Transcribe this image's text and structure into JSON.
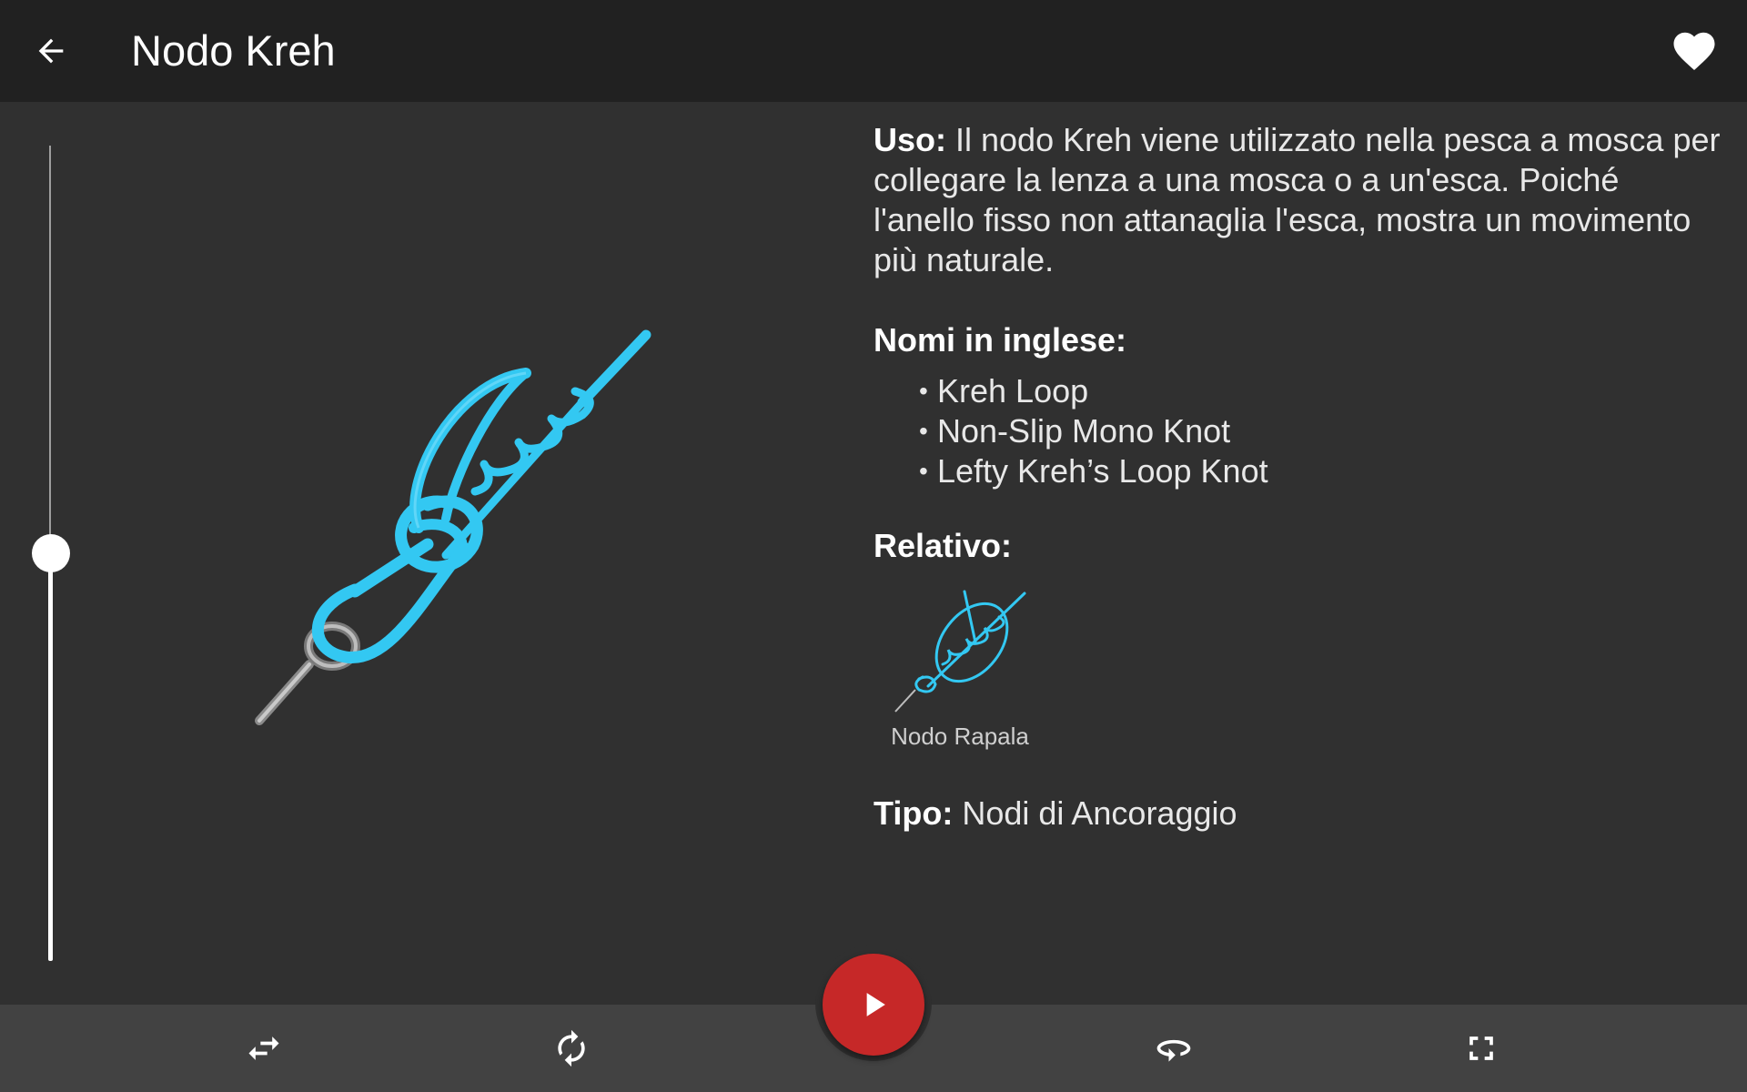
{
  "header": {
    "title": "Nodo Kreh",
    "back_icon": "arrow-back-icon",
    "favorite_icon": "heart-icon"
  },
  "slider": {
    "value_fraction": 0.5
  },
  "info": {
    "usage_label": "Uso:",
    "usage_text": " Il nodo Kreh viene utilizzato nella pesca a mosca per collegare la lenza a una mosca o a un'esca. Poiché l'anello fisso non attanaglia l'esca, mostra un movimento più naturale.",
    "english_names_title": "Nomi in inglese:",
    "english_names": [
      "Kreh Loop",
      "Non-Slip Mono Knot",
      "Lefty Kreh’s Loop Knot"
    ],
    "related_title": "Relativo:",
    "related": [
      {
        "label": "Nodo Rapala"
      }
    ],
    "type_label": "Tipo:",
    "type_value": " Nodi di Ancoraggio"
  },
  "bottom_bar": {
    "buttons": [
      "swap-horiz-icon",
      "autorenew-icon",
      "play-icon",
      "rotate-360-icon",
      "fullscreen-icon"
    ]
  },
  "colors": {
    "rope": "#33c8f2",
    "fab": "#c62828",
    "appbar": "#212121",
    "background": "#303030",
    "bottom_bar": "#424242"
  }
}
